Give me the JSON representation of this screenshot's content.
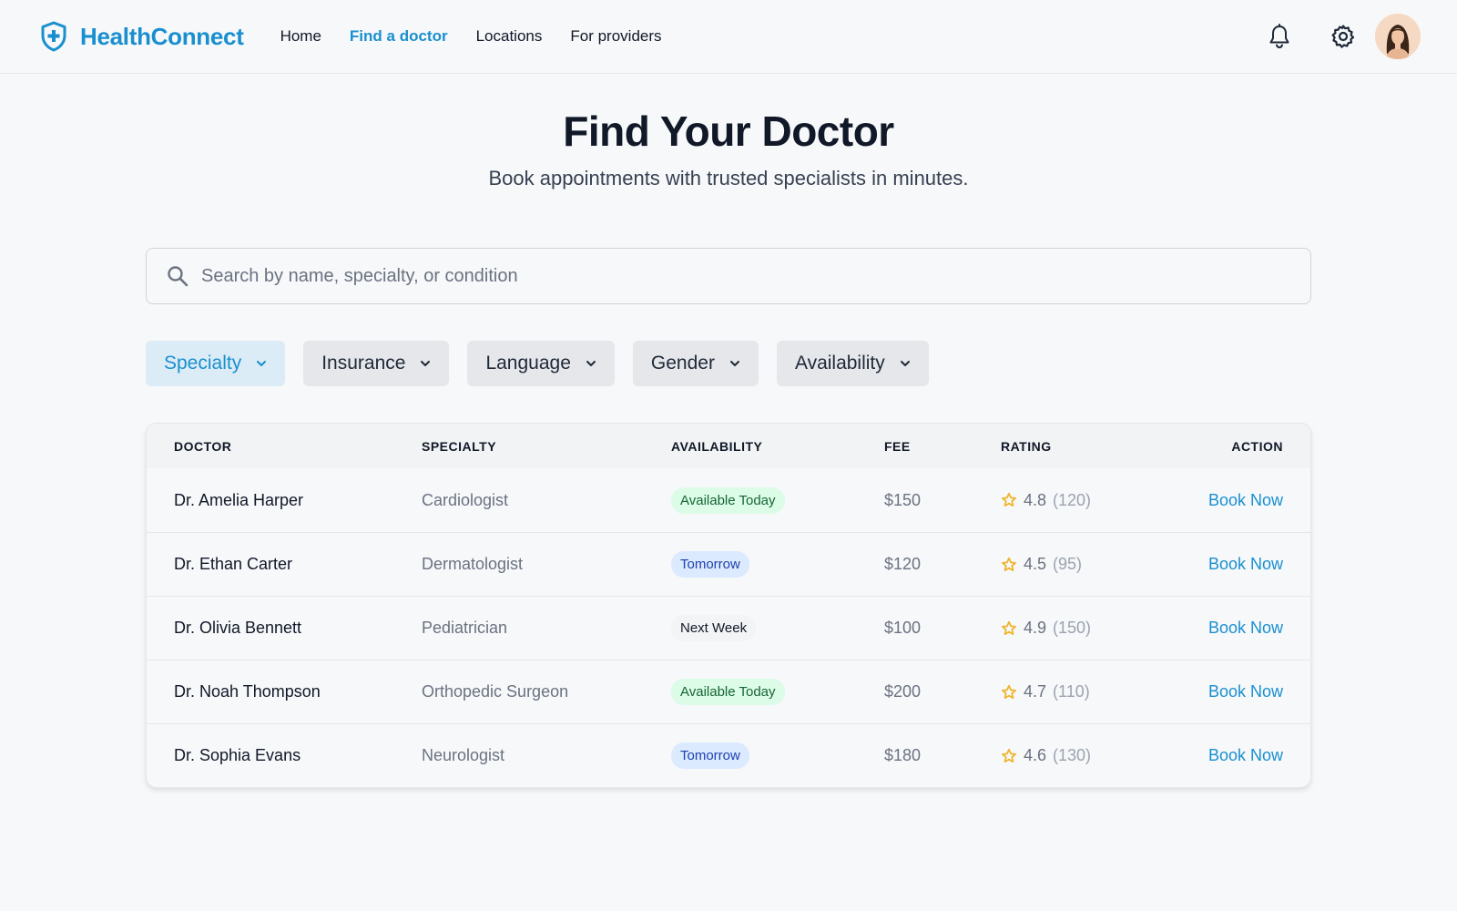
{
  "header": {
    "brand": "HealthConnect",
    "nav": [
      "Home",
      "Find a doctor",
      "Locations",
      "For providers"
    ],
    "active_nav": "Find a doctor",
    "icons": [
      "bell-icon",
      "gear-icon"
    ]
  },
  "hero": {
    "title": "Find Your Doctor",
    "subtitle": "Book appointments with trusted specialists in minutes."
  },
  "search": {
    "placeholder": "Search by name, specialty, or condition",
    "value": ""
  },
  "filters": [
    "Specialty",
    "Insurance",
    "Language",
    "Gender",
    "Availability"
  ],
  "active_filter": "Specialty",
  "table": {
    "headers": [
      "DOCTOR",
      "SPECIALTY",
      "AVAILABILITY",
      "FEE",
      "RATING",
      "ACTION"
    ],
    "rows": [
      {
        "name": "Dr. Amelia Harper",
        "specialty": "Cardiologist",
        "availability": "Available Today",
        "fee": "$150",
        "rating": "4.8",
        "reviews": "(120)",
        "action": "Book Now"
      },
      {
        "name": "Dr. Ethan Carter",
        "specialty": "Dermatologist",
        "availability": "Tomorrow",
        "fee": "$120",
        "rating": "4.5",
        "reviews": "(95)",
        "action": "Book Now"
      },
      {
        "name": "Dr. Olivia Bennett",
        "specialty": "Pediatrician",
        "availability": "Next Week",
        "fee": "$100",
        "rating": "4.9",
        "reviews": "(150)",
        "action": "Book Now"
      },
      {
        "name": "Dr. Noah Thompson",
        "specialty": "Orthopedic Surgeon",
        "availability": "Available Today",
        "fee": "$200",
        "rating": "4.7",
        "reviews": "(110)",
        "action": "Book Now"
      },
      {
        "name": "Dr. Sophia Evans",
        "specialty": "Neurologist",
        "availability": "Tomorrow",
        "fee": "$180",
        "rating": "4.6",
        "reviews": "(130)",
        "action": "Book Now"
      }
    ]
  },
  "colors": {
    "brand": "#1a8fcf",
    "available_today_bg": "#dcfce7",
    "tomorrow_bg": "#dbeafe",
    "star": "#f0b429"
  }
}
